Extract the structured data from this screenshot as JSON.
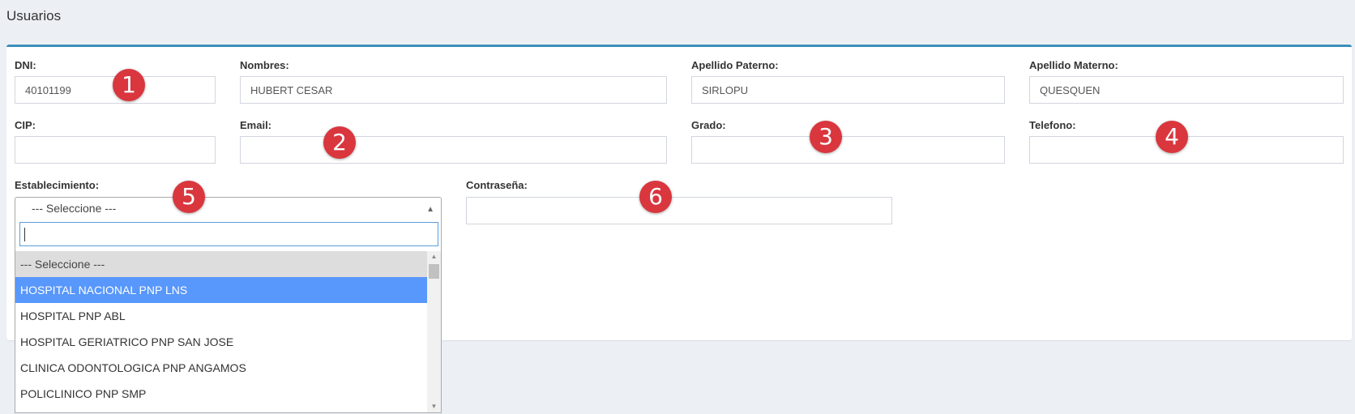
{
  "page": {
    "title": "Usuarios"
  },
  "form": {
    "dni": {
      "label": "DNI:",
      "value": "40101199"
    },
    "nombres": {
      "label": "Nombres:",
      "value": "HUBERT CESAR"
    },
    "apellido_paterno": {
      "label": "Apellido Paterno:",
      "value": "SIRLOPU"
    },
    "apellido_materno": {
      "label": "Apellido Materno:",
      "value": "QUESQUEN"
    },
    "cip": {
      "label": "CIP:",
      "value": ""
    },
    "email": {
      "label": "Email:",
      "value": ""
    },
    "grado": {
      "label": "Grado:",
      "value": ""
    },
    "telefono": {
      "label": "Telefono:",
      "value": ""
    },
    "establecimiento": {
      "label": "Establecimiento:",
      "selected": "--- Seleccione ---",
      "search_value": "",
      "options": [
        "--- Seleccione ---",
        "HOSPITAL NACIONAL PNP LNS",
        "HOSPITAL PNP ABL",
        "HOSPITAL GERIATRICO PNP SAN JOSE",
        "CLINICA ODONTOLOGICA PNP ANGAMOS",
        "POLICLINICO PNP SMP"
      ],
      "highlighted_index": 1
    },
    "contrasena": {
      "label": "Contraseña:",
      "value": ""
    }
  },
  "badges": [
    "1",
    "2",
    "3",
    "4",
    "5",
    "6"
  ],
  "colors": {
    "accent": "#3c8dbc",
    "badge": "#d9363e",
    "highlight": "#5897fb"
  }
}
